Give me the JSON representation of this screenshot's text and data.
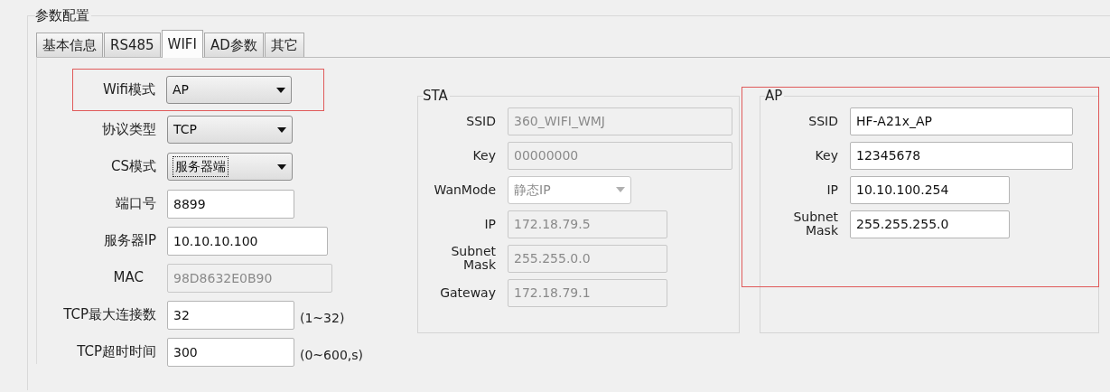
{
  "group_title": "参数配置",
  "tabs": [
    {
      "label": "基本信息",
      "selected": false
    },
    {
      "label": "RS485",
      "selected": false
    },
    {
      "label": "WIFI",
      "selected": true
    },
    {
      "label": "AD参数",
      "selected": false
    },
    {
      "label": "其它",
      "selected": false
    }
  ],
  "settings": [
    {
      "label": "Wifi模式",
      "kind": "select",
      "value": "AP",
      "highlighted": true,
      "disabled": false,
      "focused": false
    },
    {
      "label": "协议类型",
      "kind": "select",
      "value": "TCP",
      "highlighted": false,
      "disabled": false,
      "focused": false
    },
    {
      "label": "CS模式",
      "kind": "select",
      "value": "服务器端",
      "highlighted": false,
      "disabled": false,
      "focused": true
    },
    {
      "label": "端口号",
      "kind": "input",
      "value": "8899",
      "highlighted": false,
      "disabled": false,
      "focused": false
    },
    {
      "label": "服务器IP",
      "kind": "input",
      "value": "10.10.10.100",
      "highlighted": false,
      "disabled": false,
      "focused": false
    },
    {
      "label": "MAC",
      "kind": "input",
      "value": "98D8632E0B90",
      "highlighted": false,
      "disabled": true,
      "focused": false
    },
    {
      "label": "TCP最大连接数",
      "kind": "input",
      "value": "32",
      "hint": "(1~32)",
      "highlighted": false,
      "disabled": false,
      "focused": false
    },
    {
      "label": "TCP超时时间",
      "kind": "input",
      "value": "300",
      "hint": "(0~600,s)",
      "highlighted": false,
      "disabled": false,
      "focused": false
    }
  ],
  "sta": {
    "title": "STA",
    "highlighted": false,
    "fields": [
      {
        "label": "SSID",
        "kind": "input",
        "value": "360_WIFI_WMJ",
        "disabled": true
      },
      {
        "label": "Key",
        "kind": "input",
        "value": "00000000",
        "disabled": true
      },
      {
        "label": "WanMode",
        "kind": "select",
        "value": "静态IP",
        "disabled": true
      },
      {
        "label": "IP",
        "kind": "input",
        "value": "172.18.79.5",
        "disabled": true
      },
      {
        "label": "Subnet Mask",
        "kind": "input",
        "value": "255.255.0.0",
        "disabled": true
      },
      {
        "label": "Gateway",
        "kind": "input",
        "value": "172.18.79.1",
        "disabled": true
      }
    ]
  },
  "ap": {
    "title": "AP",
    "highlighted": true,
    "fields": [
      {
        "label": "SSID",
        "kind": "input",
        "value": "HF-A21x_AP",
        "disabled": false
      },
      {
        "label": "Key",
        "kind": "input",
        "value": "12345678",
        "disabled": false
      },
      {
        "label": "IP",
        "kind": "input",
        "value": "10.10.100.254",
        "disabled": false
      },
      {
        "label": "Subnet Mask",
        "kind": "input",
        "value": "255.255.255.0",
        "disabled": false
      }
    ]
  }
}
